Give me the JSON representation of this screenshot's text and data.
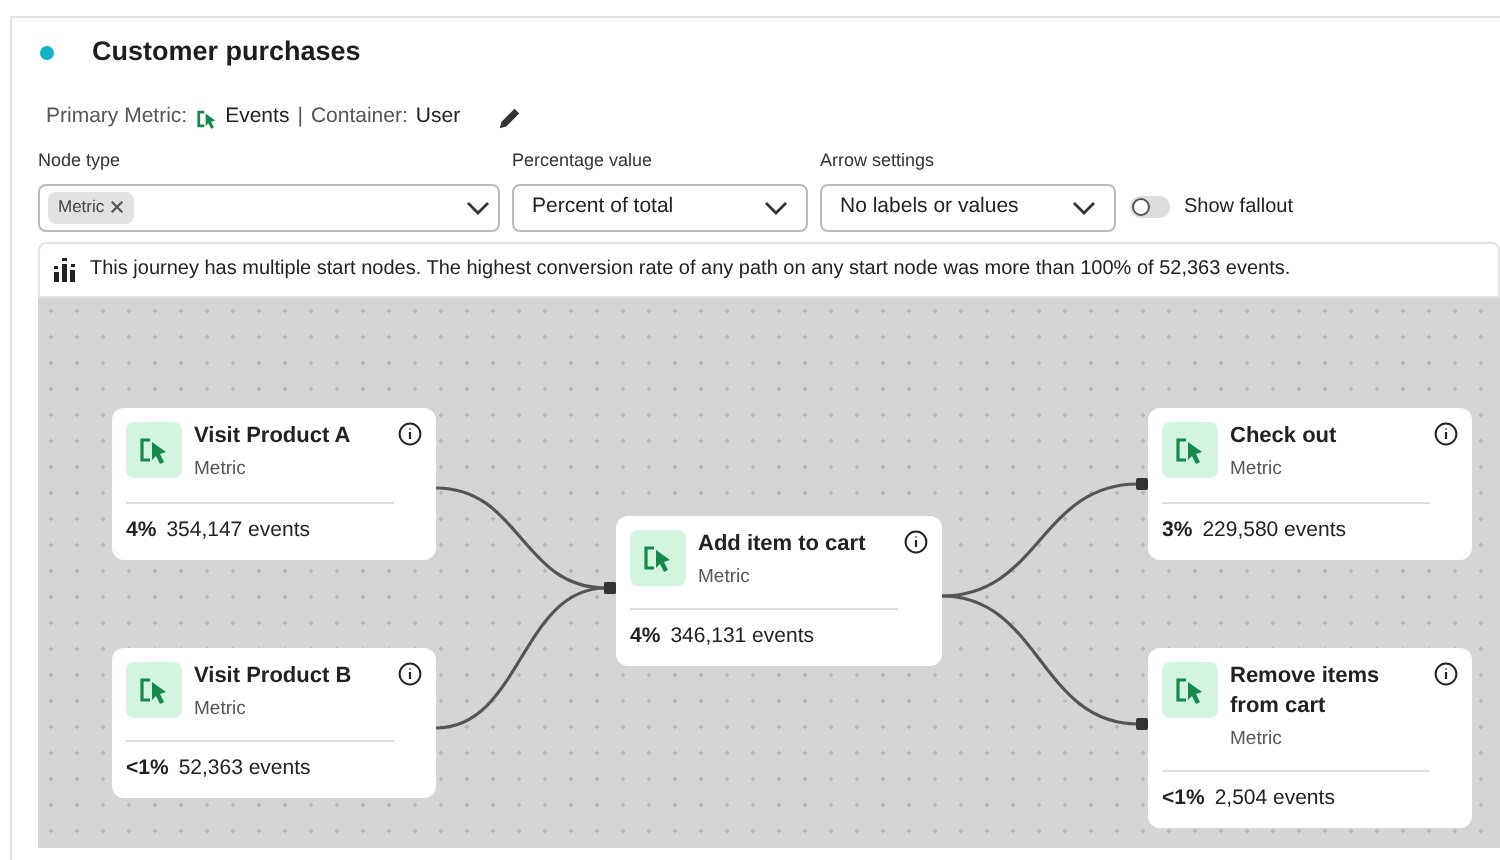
{
  "title": "Customer purchases",
  "summary": {
    "metric_label": "Primary Metric:",
    "metric": "Events",
    "separator": "|",
    "container_label": "Container:",
    "container": "User"
  },
  "filters": [
    {
      "kind": "tags",
      "label": "Node type",
      "tags": [
        "Metric"
      ]
    },
    {
      "kind": "select",
      "label": "Percentage value",
      "value": "Percent of total"
    },
    {
      "kind": "select",
      "label": "Arrow settings",
      "value": "No labels or values"
    }
  ],
  "fallout_toggle": {
    "label": "Show fallout",
    "on": false
  },
  "notice": "This journey has multiple start nodes. The highest conversion rate of any path on any start node was more than 100% of 52,363 events.",
  "nodes": [
    {
      "title": "Visit Product A",
      "type": "Metric",
      "percent": "4%",
      "count": "354,147 events"
    },
    {
      "title": "Visit Product B",
      "type": "Metric",
      "percent": "<1%",
      "count": "52,363 events"
    },
    {
      "title": "Add item to cart",
      "type": "Metric",
      "percent": "4%",
      "count": "346,131 events"
    },
    {
      "title": "Check out",
      "type": "Metric",
      "percent": "3%",
      "count": "229,580 events"
    },
    {
      "title": "Remove items from cart",
      "type": "Metric",
      "percent": "<1%",
      "count": "2,504 events"
    }
  ]
}
